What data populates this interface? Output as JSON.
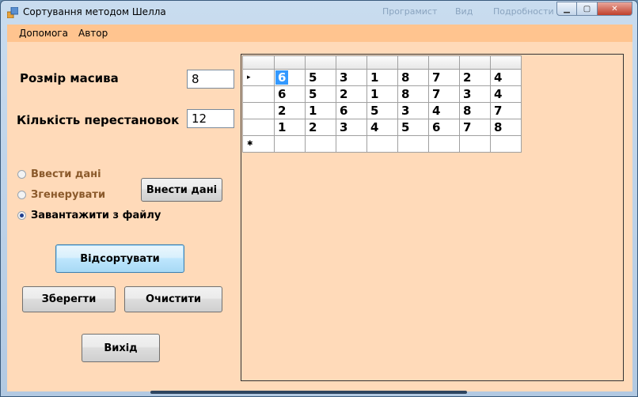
{
  "window": {
    "title": "Сортування методом Шелла",
    "bg_ghost": [
      "Програмист",
      "Вид",
      "Подробности"
    ],
    "controls": {
      "minimize": "▁",
      "maximize": "▢",
      "close": "✕"
    }
  },
  "menu": [
    "Допомога",
    "Автор"
  ],
  "form": {
    "size_label": "Розмір масива",
    "size_value": "8",
    "perm_label": "Кількість перестановок",
    "perm_value": "12"
  },
  "radios": [
    {
      "label": "Ввести дані",
      "checked": false,
      "enabled": false
    },
    {
      "label": "Згенерувати",
      "checked": false,
      "enabled": false
    },
    {
      "label": "Завантажити з файлу",
      "checked": true,
      "enabled": true
    }
  ],
  "buttons": {
    "enter_data": "Внести дані",
    "sort": "Відсортувати",
    "save": "Зберегти",
    "clear": "Очистити",
    "exit": "Вихід"
  },
  "grid": {
    "row_markers": [
      "▸",
      "",
      "",
      "",
      "✱"
    ],
    "rows": [
      [
        "6",
        "5",
        "3",
        "1",
        "8",
        "7",
        "2",
        "4"
      ],
      [
        "6",
        "5",
        "2",
        "1",
        "8",
        "7",
        "3",
        "4"
      ],
      [
        "2",
        "1",
        "6",
        "5",
        "3",
        "4",
        "8",
        "7"
      ],
      [
        "1",
        "2",
        "3",
        "4",
        "5",
        "6",
        "7",
        "8"
      ],
      [
        "",
        "",
        "",
        "",
        "",
        "",
        "",
        ""
      ]
    ]
  },
  "colors": {
    "form_bg": "#ffdab9",
    "menu_bg": "#ffc48f",
    "selection": "#3399ff"
  }
}
